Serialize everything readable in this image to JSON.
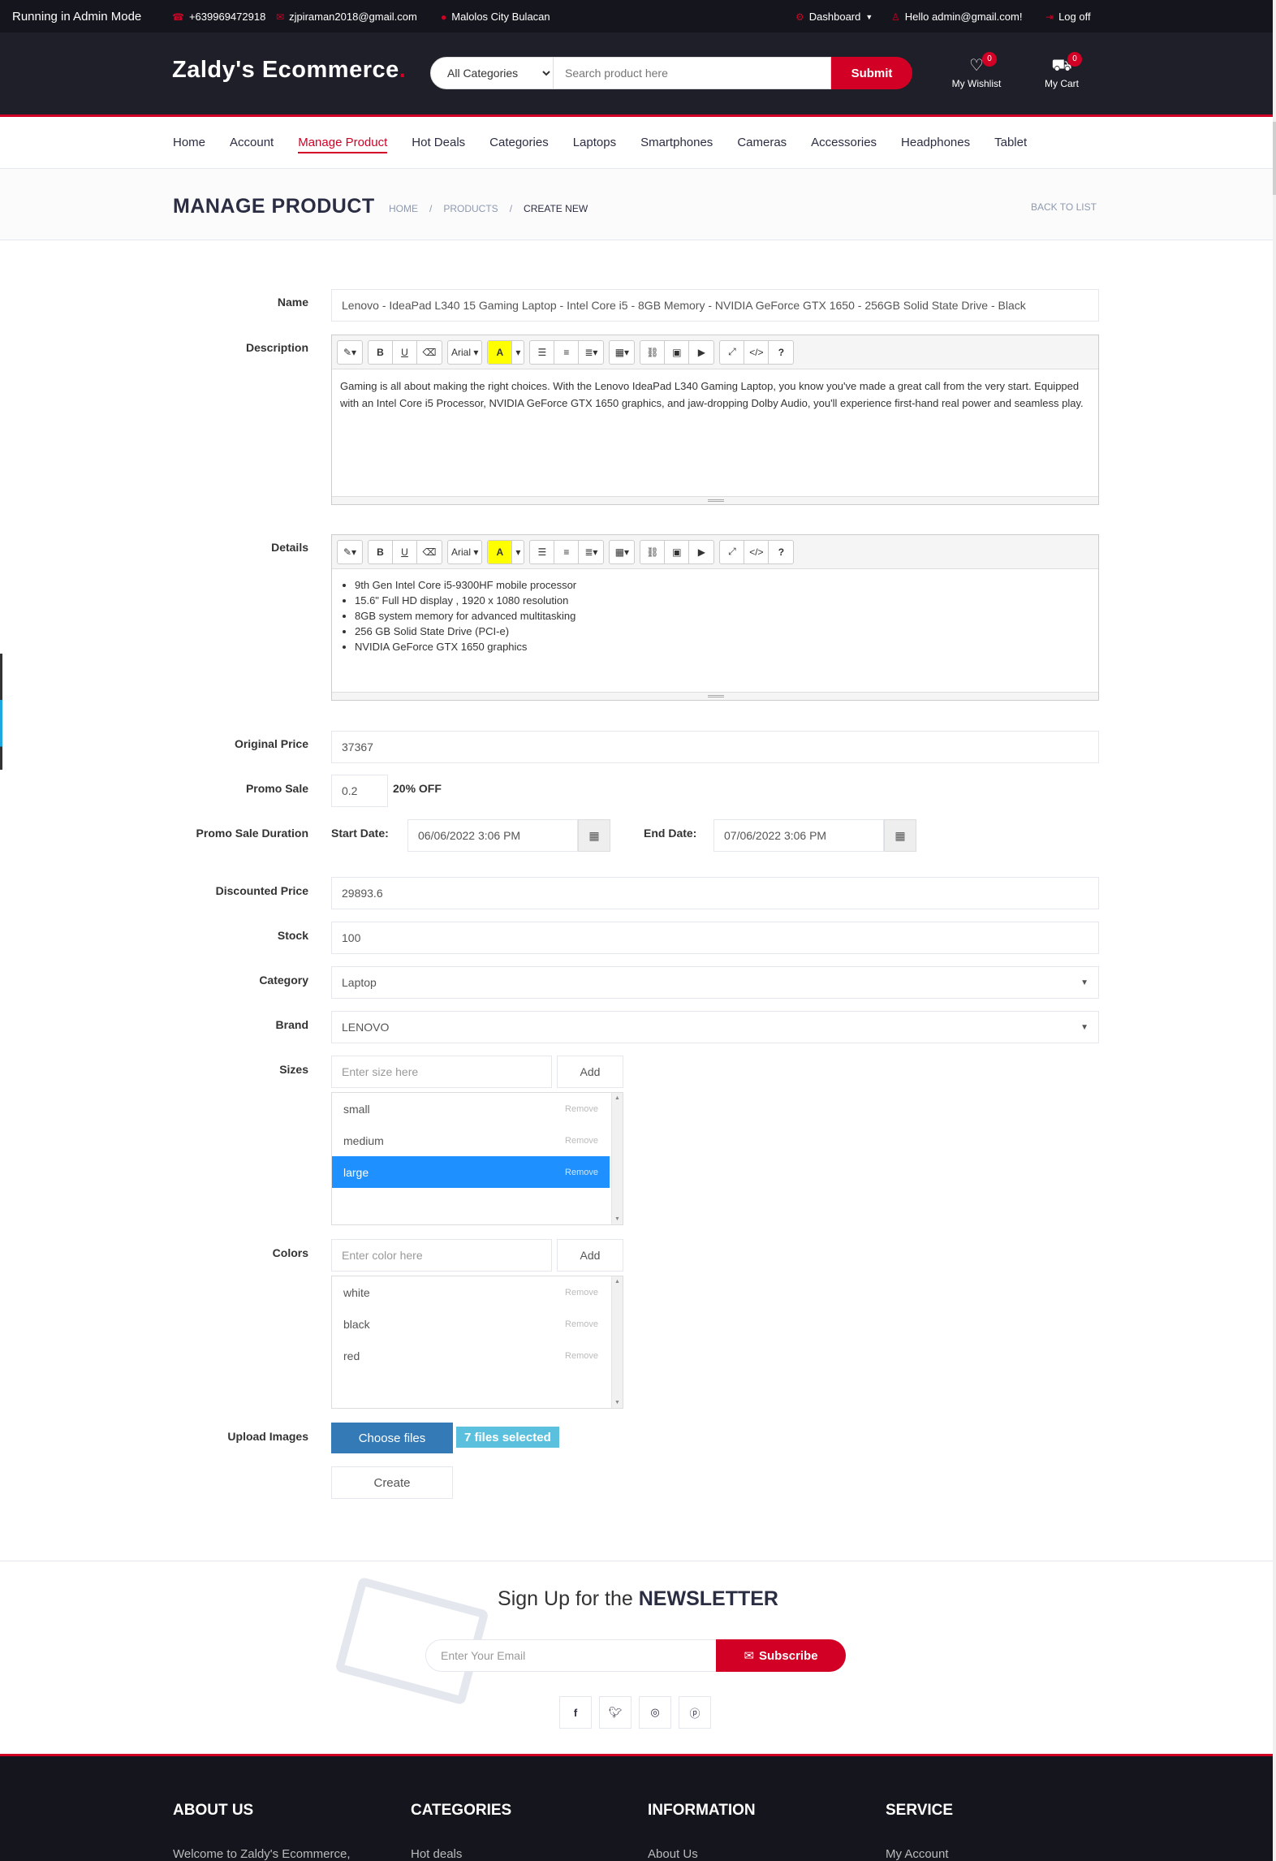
{
  "topbar": {
    "admin_mode": "Running in Admin Mode",
    "phone": "+639969472918",
    "email": "zjpiraman2018@gmail.com",
    "location": "Malolos City Bulacan",
    "dashboard": "Dashboard",
    "greeting": "Hello admin@gmail.com!",
    "logoff": "Log off"
  },
  "header": {
    "logo": "Zaldy's Ecommerce",
    "logo_dot": ".",
    "search_category": "All Categories",
    "search_placeholder": "Search product here",
    "search_button": "Submit",
    "wishlist_label": "My Wishlist",
    "wishlist_qty": "0",
    "cart_label": "My Cart",
    "cart_qty": "0"
  },
  "nav": [
    "Home",
    "Account",
    "Manage Product",
    "Hot Deals",
    "Categories",
    "Laptops",
    "Smartphones",
    "Cameras",
    "Accessories",
    "Headphones",
    "Tablet"
  ],
  "nav_active": "Manage Product",
  "breadcrumb": {
    "title": "MANAGE PRODUCT",
    "home": "HOME",
    "products": "PRODUCTS",
    "current": "CREATE NEW",
    "back": "BACK TO LIST"
  },
  "form": {
    "name_label": "Name",
    "name_value": "Lenovo - IdeaPad L340 15 Gaming Laptop - Intel Core i5 - 8GB Memory - NVIDIA GeForce GTX 1650 - 256GB Solid State Drive - Black",
    "description_label": "Description",
    "editor_font": "Arial",
    "description_text": "Gaming is all about making the right choices. With the Lenovo IdeaPad L340 Gaming Laptop, you know you've made a great call from the very start. Equipped with an Intel Core i5 Processor, NVIDIA GeForce GTX 1650 graphics, and jaw-dropping Dolby Audio, you'll experience first-hand real power and seamless play.",
    "details_label": "Details",
    "details_items": [
      "9th Gen Intel Core i5-9300HF mobile processor",
      "15.6\" Full HD display , 1920 x 1080 resolution",
      "8GB system memory for advanced multitasking",
      "256 GB Solid State Drive (PCI-e)",
      "NVIDIA GeForce GTX 1650 graphics"
    ],
    "original_price_label": "Original Price",
    "original_price": "37367",
    "promo_sale_label": "Promo Sale",
    "promo_sale": "0.2",
    "promo_off": "20% OFF",
    "promo_duration_label": "Promo Sale Duration",
    "start_date_label": "Start Date:",
    "start_date": "06/06/2022 3:06 PM",
    "end_date_label": "End Date:",
    "end_date": "07/06/2022 3:06 PM",
    "discounted_price_label": "Discounted Price",
    "discounted_price": "29893.6",
    "stock_label": "Stock",
    "stock": "100",
    "category_label": "Category",
    "category": "Laptop",
    "brand_label": "Brand",
    "brand": "LENOVO",
    "sizes_label": "Sizes",
    "size_placeholder": "Enter size here",
    "add_label": "Add",
    "sizes": [
      "small",
      "medium",
      "large"
    ],
    "sizes_selected": "large",
    "remove_label": "Remove",
    "colors_label": "Colors",
    "color_placeholder": "Enter color here",
    "colors": [
      "white",
      "black",
      "red"
    ],
    "upload_label": "Upload Images",
    "choose_files": "Choose files",
    "files_selected": "7 files selected",
    "create": "Create"
  },
  "newsletter": {
    "title_prefix": "Sign Up for the",
    "title_strong": "NEWSLETTER",
    "email_placeholder": "Enter Your Email",
    "subscribe": "Subscribe"
  },
  "footer": {
    "about_title": "ABOUT US",
    "about_text": "Welcome to Zaldy's Ecommerce,",
    "categories_title": "CATEGORIES",
    "categories_first": "Hot deals",
    "information_title": "INFORMATION",
    "information_first": "About Us",
    "service_title": "SERVICE",
    "service_first": "My Account"
  },
  "colors": {
    "primary": "#D10024",
    "dark": "#15161d",
    "header": "#1e1f29",
    "selected_row": "#1e90ff",
    "choose_btn": "#337ab7",
    "badge": "#5bc0de"
  }
}
